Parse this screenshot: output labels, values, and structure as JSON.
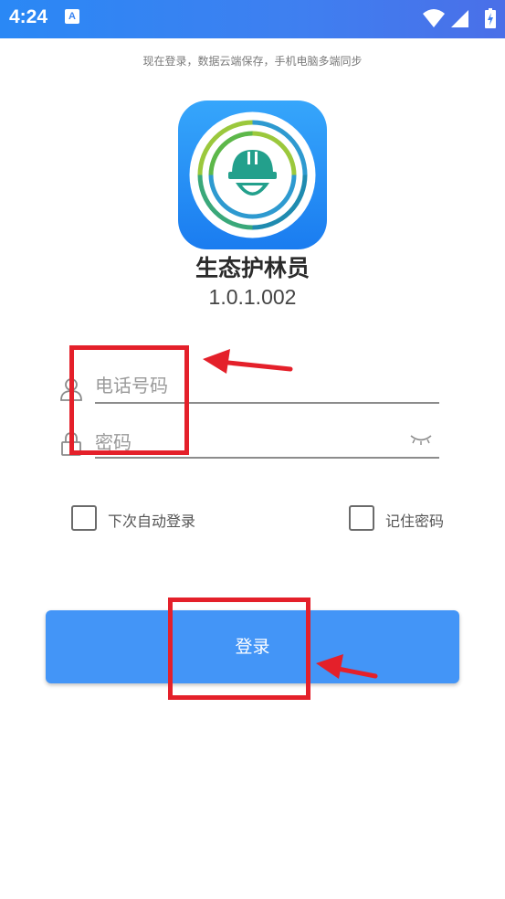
{
  "status_bar": {
    "time": "4:24",
    "notification_icon": "A"
  },
  "hint": "现在登录，数据云端保存，手机电脑多端同步",
  "app": {
    "name": "生态护林员",
    "version": "1.0.1.002"
  },
  "form": {
    "phone_placeholder": "电话号码",
    "password_placeholder": "密码",
    "auto_login_label": "下次自动登录",
    "remember_password_label": "记住密码",
    "login_label": "登录"
  },
  "colors": {
    "accent": "#4395f7",
    "status_bar": "#3a84f2",
    "annotation": "#e4202a"
  }
}
